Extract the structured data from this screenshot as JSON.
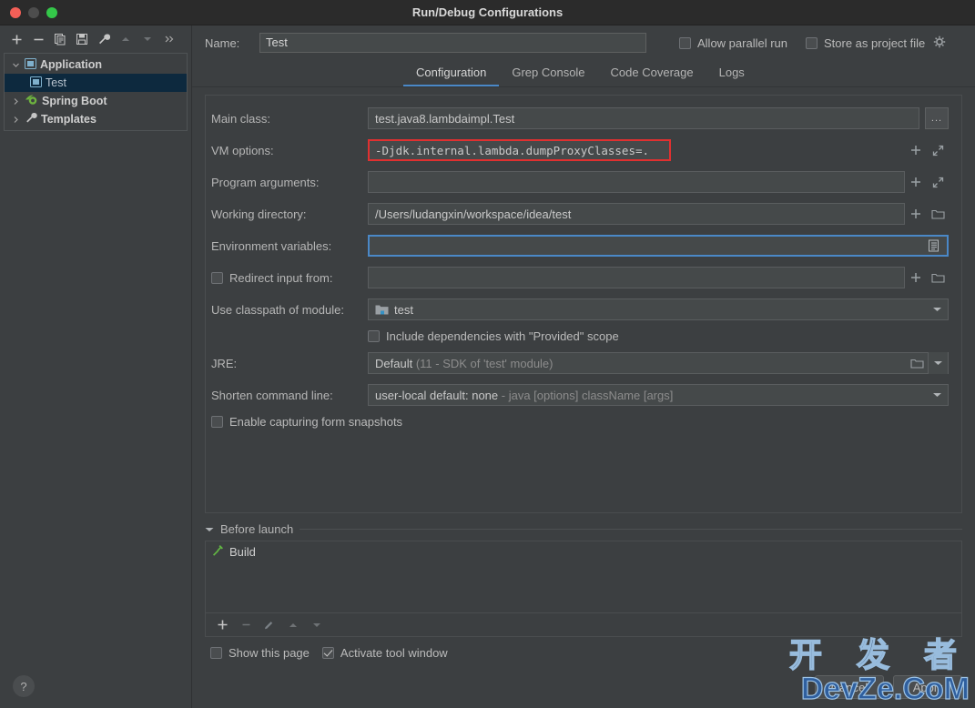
{
  "window": {
    "title": "Run/Debug Configurations",
    "traffic_lights": [
      "close",
      "minimize",
      "zoom"
    ]
  },
  "sidebar": {
    "toolbar": [
      {
        "name": "add-configuration-button",
        "icon": "plus-icon",
        "label": "+"
      },
      {
        "name": "remove-configuration-button",
        "icon": "minus-icon",
        "label": "−"
      },
      {
        "name": "copy-configuration-button",
        "icon": "copy-icon",
        "label": "copy"
      },
      {
        "name": "save-configuration-button",
        "icon": "save-icon",
        "label": "save"
      },
      {
        "name": "edit-templates-button",
        "icon": "wrench-icon",
        "label": "wrench"
      },
      {
        "name": "move-up-button",
        "icon": "triangle-up-icon",
        "label": "up"
      },
      {
        "name": "move-down-button",
        "icon": "triangle-down-icon",
        "label": "down"
      },
      {
        "name": "more-options-button",
        "icon": "chevron-double-right-icon",
        "label": "»"
      }
    ],
    "tree": [
      {
        "label": "Application",
        "icon": "application-icon",
        "twisty": "expanded",
        "level": 0,
        "selected": false
      },
      {
        "label": "Test",
        "icon": "application-icon",
        "twisty": "none",
        "level": 1,
        "selected": true
      },
      {
        "label": "Spring Boot",
        "icon": "spring-boot-icon",
        "twisty": "collapsed",
        "level": 0,
        "selected": false
      },
      {
        "label": "Templates",
        "icon": "wrench-icon",
        "twisty": "collapsed",
        "level": 0,
        "selected": false
      }
    ],
    "help_button": "?"
  },
  "header": {
    "name_label": "Name:",
    "name_value": "Test",
    "allow_parallel_run": {
      "label": "Allow parallel run",
      "checked": false
    },
    "store_as_project_file": {
      "label": "Store as project file",
      "checked": false
    },
    "gear_icon": "gear-icon"
  },
  "tabs": [
    {
      "label": "Configuration",
      "active": true
    },
    {
      "label": "Grep Console",
      "active": false
    },
    {
      "label": "Code Coverage",
      "active": false
    },
    {
      "label": "Logs",
      "active": false
    }
  ],
  "form": {
    "main_class": {
      "label": "Main class:",
      "value": "test.java8.lambdaimpl.Test",
      "browse_label": "..."
    },
    "vm_options": {
      "label": "VM options:",
      "value": "-Djdk.internal.lambda.dumpProxyClasses=.",
      "highlight_color": "#e03030"
    },
    "program_arguments": {
      "label": "Program arguments:",
      "value": ""
    },
    "working_directory": {
      "label": "Working directory:",
      "value": "/Users/ludangxin/workspace/idea/test"
    },
    "environment_variables": {
      "label": "Environment variables:",
      "value": "",
      "focused": true,
      "focus_color": "#4a88c7"
    },
    "redirect_input_from": {
      "label": "Redirect input from:",
      "checked": false,
      "value": ""
    },
    "use_classpath_of_module": {
      "label": "Use classpath of module:",
      "value": "test"
    },
    "include_provided_scope": {
      "label": "Include dependencies with \"Provided\" scope",
      "checked": false
    },
    "jre": {
      "label": "JRE:",
      "value": "Default",
      "hint": "(11 - SDK of 'test' module)"
    },
    "shorten_command_line": {
      "label": "Shorten command line:",
      "value": "user-local default: none",
      "hint": "- java [options] className [args]"
    },
    "enable_form_snapshots": {
      "label": "Enable capturing form snapshots",
      "checked": false
    }
  },
  "before_launch": {
    "title": "Before launch",
    "items": [
      {
        "label": "Build",
        "icon": "hammer-icon"
      }
    ],
    "toolbar": [
      {
        "name": "add-task-button",
        "icon": "plus-icon",
        "label": "+"
      },
      {
        "name": "remove-task-button",
        "icon": "minus-icon",
        "label": "−"
      },
      {
        "name": "edit-task-button",
        "icon": "pencil-icon",
        "label": "edit"
      },
      {
        "name": "task-move-up-button",
        "icon": "triangle-up-icon",
        "label": "up"
      },
      {
        "name": "task-move-down-button",
        "icon": "triangle-down-icon",
        "label": "down"
      }
    ]
  },
  "footer": {
    "show_this_page": {
      "label": "Show this page",
      "checked": false
    },
    "activate_tool_window": {
      "label": "Activate tool window",
      "checked": true
    },
    "cancel_button": "Cancel",
    "apply_button": "Apply"
  },
  "watermark": {
    "chinese": "开 发 者",
    "latin": "DevZe.CoM"
  }
}
